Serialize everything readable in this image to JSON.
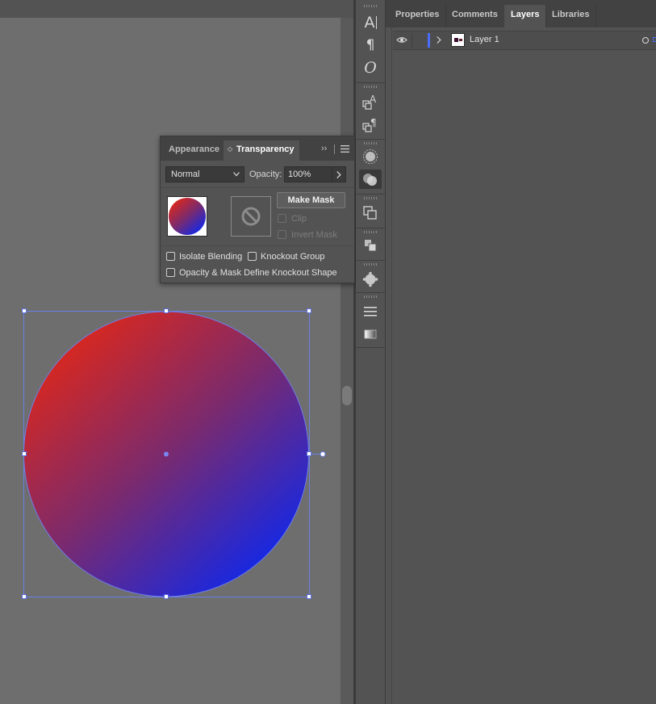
{
  "right_panel": {
    "tabs": [
      {
        "label": "Properties",
        "active": false
      },
      {
        "label": "Comments",
        "active": false
      },
      {
        "label": "Layers",
        "active": true
      },
      {
        "label": "Libraries",
        "active": false
      }
    ],
    "layers": [
      {
        "name": "Layer 1",
        "visible": true,
        "expanded": false,
        "color": "#4a6cf7"
      }
    ]
  },
  "transparency_panel": {
    "tabs": [
      {
        "label": "Appearance",
        "active": false
      },
      {
        "label": "Transparency",
        "active": true
      }
    ],
    "blend_mode": "Normal",
    "opacity_label": "Opacity:",
    "opacity_value": "100%",
    "make_mask_label": "Make Mask",
    "clip_label": "Clip",
    "invert_mask_label": "Invert Mask",
    "isolate_blending_label": "Isolate Blending",
    "knockout_group_label": "Knockout Group",
    "opacity_mask_define_label": "Opacity & Mask Define Knockout Shape",
    "isolate_blending_checked": false,
    "knockout_group_checked": false,
    "opacity_mask_define_checked": false,
    "clip_checked": false,
    "invert_mask_checked": false
  },
  "artwork": {
    "shape": "circle",
    "gradient_start": "#d9281e",
    "gradient_end": "#1428e6",
    "selection_color": "#5a6fdc"
  },
  "tool_strip_icons": [
    "character-icon",
    "paragraph-icon",
    "opentype-icon",
    "character-styles-icon",
    "paragraph-styles-icon",
    "appearance-icon",
    "transparency-icon",
    "pathfinder-icon",
    "align-icon",
    "symbols-icon",
    "stroke-icon",
    "gradient-icon"
  ]
}
